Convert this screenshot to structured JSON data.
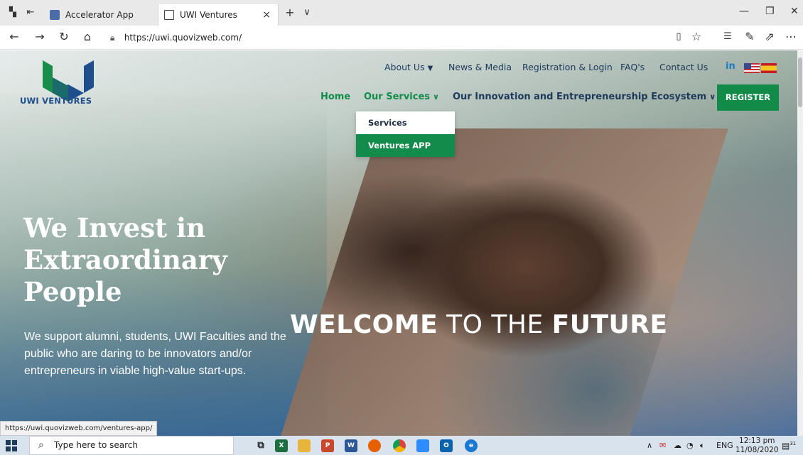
{
  "browser": {
    "tabs": [
      {
        "label": "Accelerator App",
        "icon": "app-icon"
      },
      {
        "label": "UWI Ventures",
        "icon": "page-icon"
      }
    ],
    "new_tab_glyph": "+",
    "tab_list_glyph": "∨",
    "close_glyph": "×",
    "url": "https://uwi.quovizweb.com/",
    "window_controls": [
      "—",
      "❐",
      "✕"
    ]
  },
  "site": {
    "logo_text": "UWI VENTURES",
    "top_nav": {
      "about": "About Us",
      "news": "News & Media",
      "registration": "Registration & Login",
      "faq": "FAQ's",
      "contact": "Contact Us",
      "linkedin": "in"
    },
    "main_nav": {
      "home": "Home",
      "services": "Our Services",
      "ecosystem": "Our Innovation and Entrepreneurship Ecosystem",
      "register": "REGISTER"
    },
    "dropdown": {
      "items": [
        "Services",
        "Ventures APP"
      ],
      "highlighted_index": 1
    },
    "hero": {
      "title_lines": [
        "We Invest in",
        "Extraordinary",
        "People"
      ],
      "subtitle": "We support alumni, students, UWI Faculties and the public who are daring to be innovators and/or entrepreneurs in viable high-value start-ups.",
      "welcome_1": "WELCOME",
      "welcome_2": "TO THE",
      "welcome_3": "FUTURE"
    },
    "colors": {
      "brand_green": "#138b4a",
      "brand_navy": "#1e3a5a",
      "logo_blue": "#1f4e8c"
    }
  },
  "status_bar": {
    "hover_url": "https://uwi.quovizweb.com/ventures-app/"
  },
  "taskbar": {
    "search_placeholder": "Type here to search",
    "apps": [
      "task-view-icon",
      "excel-icon",
      "file-explorer-icon",
      "powerpoint-icon",
      "word-icon",
      "firefox-icon",
      "chrome-icon",
      "zoom-icon",
      "outlook-icon",
      "edge-icon"
    ],
    "language": "ENG",
    "time": "12:13 pm",
    "date": "11/08/2020",
    "notification_count": "31"
  }
}
